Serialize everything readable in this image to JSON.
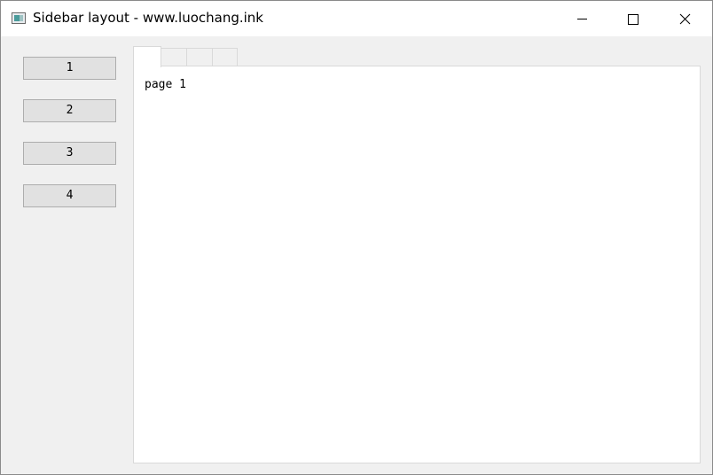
{
  "window": {
    "title": "Sidebar layout - www.luochang.ink",
    "icon": "app-window-icon",
    "caption_icons": [
      "minimize-icon",
      "maximize-icon",
      "close-icon"
    ]
  },
  "sidebar": {
    "buttons": [
      {
        "label": "1"
      },
      {
        "label": "2"
      },
      {
        "label": "3"
      },
      {
        "label": "4"
      }
    ]
  },
  "tabs": {
    "items": [
      {
        "label": ""
      },
      {
        "label": ""
      },
      {
        "label": ""
      },
      {
        "label": ""
      }
    ],
    "active_index": 0
  },
  "content": {
    "page_text": "page 1"
  }
}
